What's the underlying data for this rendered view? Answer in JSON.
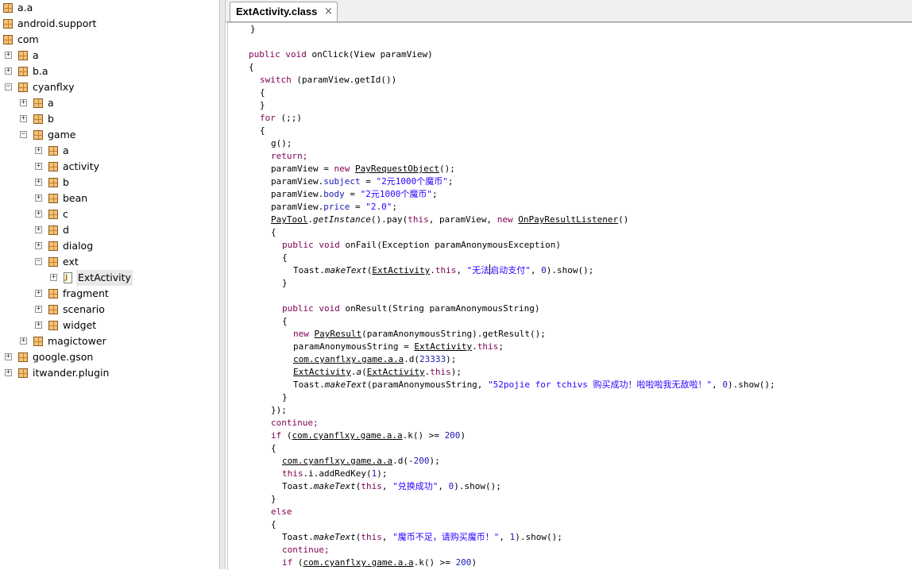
{
  "tab": {
    "title": "ExtActivity.class",
    "close_glyph": "×"
  },
  "tree": [
    {
      "label": "a.a"
    },
    {
      "label": "android.support"
    },
    {
      "label": "com"
    },
    {
      "label": "a"
    },
    {
      "label": "b.a"
    },
    {
      "label": "cyanflxy"
    },
    {
      "label": "a"
    },
    {
      "label": "b"
    },
    {
      "label": "game"
    },
    {
      "label": "a"
    },
    {
      "label": "activity"
    },
    {
      "label": "b"
    },
    {
      "label": "bean"
    },
    {
      "label": "c"
    },
    {
      "label": "d"
    },
    {
      "label": "dialog"
    },
    {
      "label": "ext"
    },
    {
      "label": "ExtActivity"
    },
    {
      "label": "fragment"
    },
    {
      "label": "scenario"
    },
    {
      "label": "widget"
    },
    {
      "label": "magictower"
    },
    {
      "label": "google.gson"
    },
    {
      "label": "itwander.plugin"
    }
  ],
  "code": {
    "l0": "}",
    "l2a": "public void",
    "l2b": " onClick(View paramView)",
    "l3": "{",
    "l4a": "switch",
    "l4b": " (paramView.getId())",
    "l5": "{",
    "l6": "}",
    "l7a": "for",
    "l7b": " (;;)",
    "l8": "{",
    "l9": "g();",
    "l10": "return;",
    "l11a": "paramView = ",
    "l11b": "new",
    "l11c": " ",
    "l11d": "PayRequestObject",
    "l11e": "();",
    "l12a": "paramView.",
    "l12b": "subject",
    "l12c": " = ",
    "l12d": "\"2元1000个魔币\"",
    "l12e": ";",
    "l13a": "paramView.",
    "l13b": "body",
    "l13c": " = ",
    "l13d": "\"2元1000个魔币\"",
    "l13e": ";",
    "l14a": "paramView.",
    "l14b": "price",
    "l14c": " = ",
    "l14d": "\"2.0\"",
    "l14e": ";",
    "l15a": "PayTool",
    "l15b": ".",
    "l15c": "getInstance",
    "l15d": "().pay(",
    "l15e": "this",
    "l15f": ", paramView, ",
    "l15g": "new",
    "l15h": " ",
    "l15i": "OnPayResultListener",
    "l15j": "()",
    "l16": "{",
    "l17a": "public void",
    "l17b": " onFail(Exception paramAnonymousException)",
    "l18": "{",
    "l19a": "Toast.",
    "l19b": "makeText",
    "l19c": "(",
    "l19d": "ExtActivity",
    "l19e": ".",
    "l19f": "this",
    "l19g": ", ",
    "l19h1": "\"无法",
    "l19h2": "启动支付\"",
    "l19i": ", ",
    "l19j": "0",
    "l19k": ").show();",
    "l20": "}",
    "l22a": "public void",
    "l22b": " onResult(String paramAnonymousString)",
    "l23": "{",
    "l24a": "new",
    "l24b": " ",
    "l24c": "PayResult",
    "l24d": "(paramAnonymousString).getResult();",
    "l25a": "paramAnonymousString = ",
    "l25b": "ExtActivity",
    "l25c": ".",
    "l25d": "this",
    "l25e": ";",
    "l26a": "com.cyanflxy.game.a.a",
    "l26b": ".d(",
    "l26c": "23333",
    "l26d": ");",
    "l27a": "ExtActivity",
    "l27b": ".",
    "l27c": "a",
    "l27d": "(",
    "l27e": "ExtActivity",
    "l27f": ".",
    "l27g": "this",
    "l27h": ");",
    "l28a": "Toast.",
    "l28b": "makeText",
    "l28c": "(paramAnonymousString, ",
    "l28d": "\"52pojie for tchivs 购买成功！啦啦啦我无敌啦！\"",
    "l28e": ", ",
    "l28f": "0",
    "l28g": ").show();",
    "l29": "}",
    "l30": "});",
    "l31": "continue;",
    "l32a": "if",
    "l32b": " (",
    "l32c": "com.cyanflxy.game.a.a",
    "l32d": ".k() >= ",
    "l32e": "200",
    "l32f": ")",
    "l33": "{",
    "l34a": "com.cyanflxy.game.a.a",
    "l34b": ".d(-",
    "l34c": "200",
    "l34d": ");",
    "l35a": "this",
    "l35b": ".i.addRedKey(",
    "l35c": "1",
    "l35d": ");",
    "l36a": "Toast.",
    "l36b": "makeText",
    "l36c": "(",
    "l36d": "this",
    "l36e": ", ",
    "l36f": "\"兑换成功\"",
    "l36g": ", ",
    "l36h": "0",
    "l36i": ").show();",
    "l37": "}",
    "l38": "else",
    "l39": "{",
    "l40a": "Toast.",
    "l40b": "makeText",
    "l40c": "(",
    "l40d": "this",
    "l40e": ", ",
    "l40f": "\"魔币不足，请购买魔币！\"",
    "l40g": ", ",
    "l40h": "1",
    "l40i": ").show();",
    "l41": "continue;",
    "l42a": "if",
    "l42b": " (",
    "l42c": "com.cyanflxy.game.a.a",
    "l42d": ".k() >= ",
    "l42e": "200",
    "l42f": ")"
  },
  "colors": {
    "keyword": "#7f0055",
    "string": "#2a00ff",
    "number": "#1a1ab4"
  }
}
